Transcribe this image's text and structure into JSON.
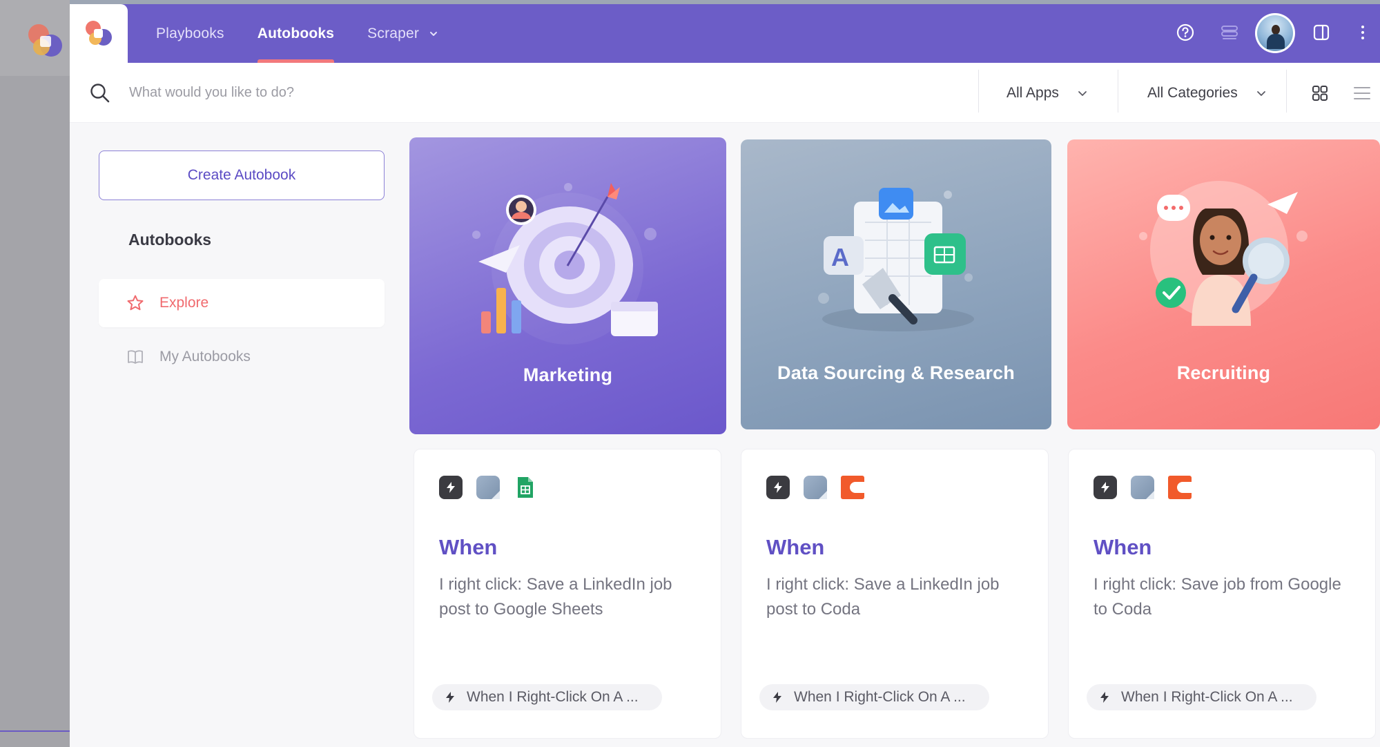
{
  "nav": {
    "items": [
      {
        "label": "Playbooks",
        "active": false
      },
      {
        "label": "Autobooks",
        "active": true
      },
      {
        "label": "Scraper",
        "active": false,
        "has_dropdown": true
      }
    ]
  },
  "header_icons": [
    "help-icon",
    "layers-icon",
    "avatar",
    "sidebar-toggle-icon",
    "more-vertical-icon"
  ],
  "search": {
    "placeholder": "What would you like to do?",
    "apps_filter": "All Apps",
    "categories_filter": "All Categories",
    "view_modes": [
      "grid-view-icon",
      "list-view-icon"
    ]
  },
  "sidebar": {
    "create_label": "Create Autobook",
    "title": "Autobooks",
    "items": [
      {
        "label": "Explore",
        "icon": "star-icon",
        "active": true
      },
      {
        "label": "My Autobooks",
        "icon": "book-icon",
        "active": false
      }
    ]
  },
  "categories": [
    {
      "label": "Marketing",
      "color": "#8a78d9"
    },
    {
      "label": "Data Sourcing & Research",
      "color": "#8ea4bd"
    },
    {
      "label": "Recruiting",
      "color": "#fb8b89"
    }
  ],
  "cards": [
    {
      "apps": [
        "bolt-icon",
        "note-icon",
        "google-sheets-icon"
      ],
      "heading": "When",
      "description": "I right click: Save a LinkedIn job post to Google Sheets",
      "trigger": "When I Right-Click On A ..."
    },
    {
      "apps": [
        "bolt-icon",
        "note-icon",
        "coda-icon"
      ],
      "heading": "When",
      "description": "I right click: Save a LinkedIn job post to Coda",
      "trigger": "When I Right-Click On A ..."
    },
    {
      "apps": [
        "bolt-icon",
        "note-icon",
        "coda-icon"
      ],
      "heading": "When",
      "description": "I right click: Save job from Google to Coda",
      "trigger": "When I Right-Click On A ..."
    }
  ],
  "colors": {
    "brand": "#6c5dc7",
    "accent": "#f06a6e",
    "heading": "#6050c4"
  }
}
